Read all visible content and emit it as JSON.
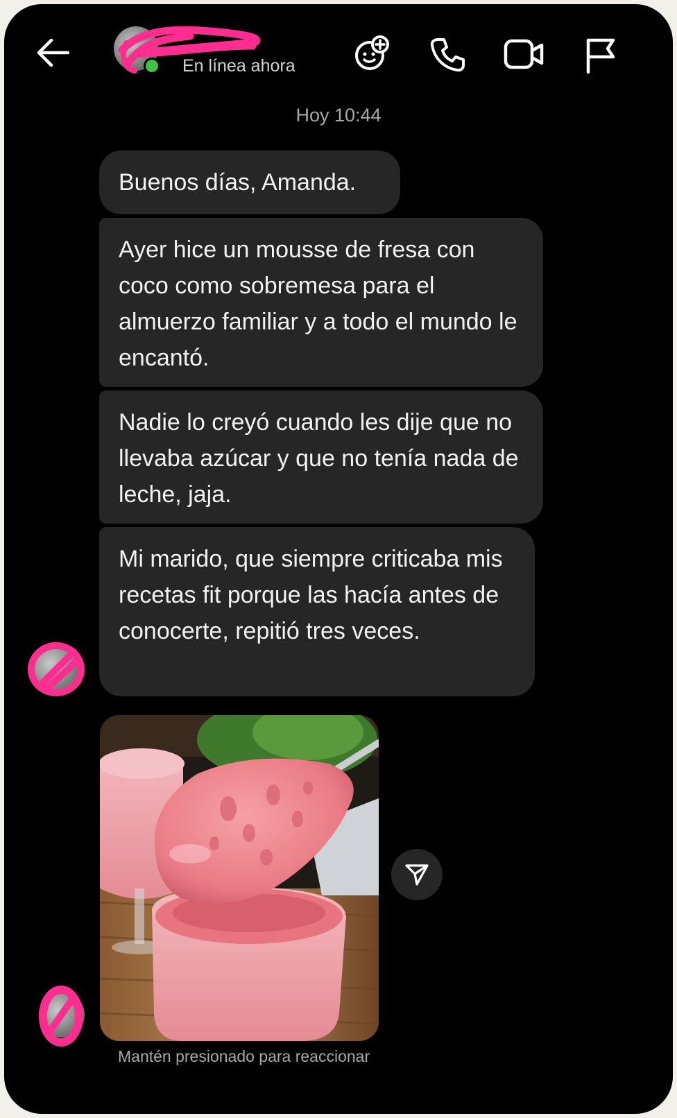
{
  "header": {
    "back_icon": "arrow-left-icon",
    "contact_name": "",
    "status": "En línea ahora",
    "actions": [
      {
        "name": "effects-icon"
      },
      {
        "name": "phone-icon"
      },
      {
        "name": "video-icon"
      },
      {
        "name": "flag-icon"
      }
    ]
  },
  "conversation": {
    "timestamp": "Hoy 10:44",
    "messages": [
      {
        "text": "Buenos días, Amanda."
      },
      {
        "text": "Ayer hice un mousse de fresa con coco como sobremesa para el almuerzo familiar y a todo el mundo le encantó."
      },
      {
        "text": "Nadie lo creyó cuando les dije que no llevaba azúcar y que no tenía nada de leche, jaja."
      },
      {
        "text": "Mi marido, que siempre criticaba mis recetas fit porque las hacía antes de conocerte, repitió tres veces."
      }
    ],
    "image_message": {
      "subject": "strawberry mousse in glasses with spoon"
    },
    "hint": "Mantén presionado para reaccionar"
  },
  "colors": {
    "background": "#000000",
    "bubble": "#262626",
    "text": "#f2f2f2",
    "muted": "#a8a8a8",
    "online": "#3ec443",
    "redaction": "#ff2d8f"
  }
}
